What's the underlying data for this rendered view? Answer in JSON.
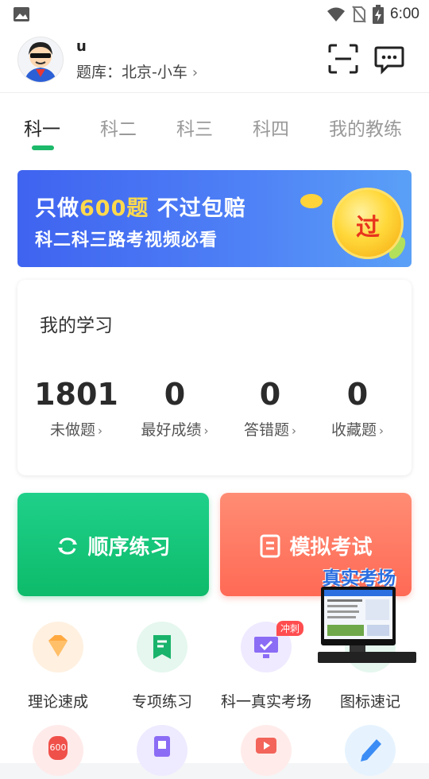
{
  "status_bar": {
    "time": "6:00",
    "icons": [
      "image-icon",
      "wifi-icon",
      "no-sim-icon",
      "battery-charging-icon"
    ]
  },
  "header": {
    "username": "u",
    "bank_label": "题库：北京-小车",
    "arrow": "›"
  },
  "tabs": [
    {
      "label": "科一",
      "active": true
    },
    {
      "label": "科二",
      "active": false
    },
    {
      "label": "科三",
      "active": false
    },
    {
      "label": "科四",
      "active": false
    },
    {
      "label": "我的教练",
      "active": false
    }
  ],
  "banner": {
    "line1_prefix": "只做",
    "line1_highlight": "600题",
    "line1_suffix": " 不过包赔",
    "line2": "科二科三路考视频必看",
    "coin_text": "过"
  },
  "study": {
    "title": "我的学习",
    "stats": [
      {
        "value": "1801",
        "label": "未做题"
      },
      {
        "value": "0",
        "label": "最好成绩"
      },
      {
        "value": "0",
        "label": "答错题"
      },
      {
        "value": "0",
        "label": "收藏题"
      }
    ],
    "chevron": "›"
  },
  "actions": {
    "sequential": "顺序练习",
    "mock_exam": "模拟考试"
  },
  "promo": {
    "title": "真实考场"
  },
  "grid": {
    "items": [
      {
        "label": "理论速成",
        "icon": "diamond-icon"
      },
      {
        "label": "专项练习",
        "icon": "bookmark-book-icon"
      },
      {
        "label": "科一真实考场",
        "icon": "monitor-check-icon",
        "badge": "冲刺"
      },
      {
        "label": "图标速记",
        "icon": "sign-icon"
      }
    ],
    "row2_icons": [
      "600-bag-icon",
      "id-card-icon",
      "video-icon",
      "pencil-icon"
    ]
  },
  "colors": {
    "accent_green": "#1db96a",
    "exam_red": "#ff6a55",
    "banner_blue": "#4f82f6"
  }
}
